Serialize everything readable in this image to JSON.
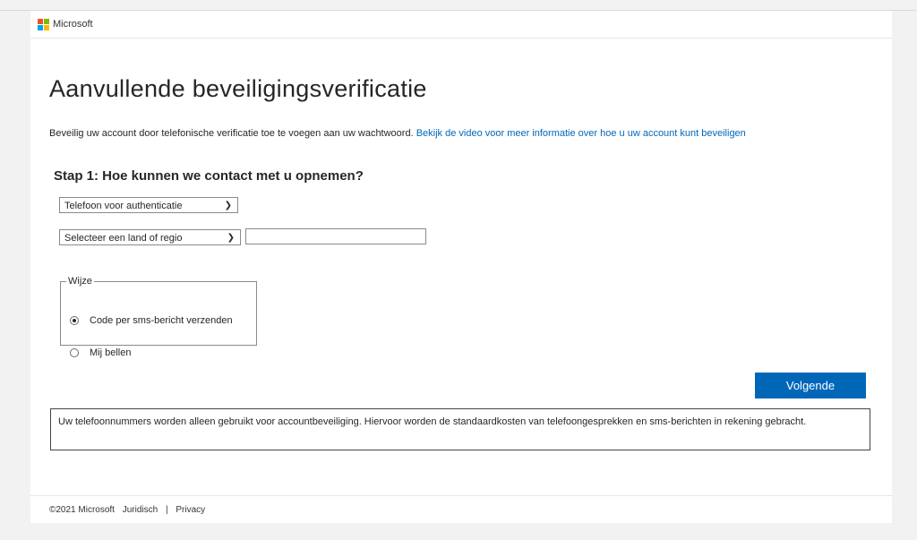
{
  "header": {
    "brand": "Microsoft"
  },
  "page": {
    "title": "Aanvullende beveiligingsverificatie",
    "intro_text": "Beveilig uw account door telefonische verificatie toe te voegen aan uw wachtwoord.",
    "intro_link": "Bekijk de video voor meer informatie over hoe u uw account kunt beveiligen"
  },
  "step1": {
    "heading": "Stap 1: Hoe kunnen we contact met u opnemen?",
    "method_select": "Telefoon voor authenticatie",
    "country_select": "Selecteer een land of regio",
    "phone_value": "",
    "method_group": {
      "legend": "Wijze",
      "options": [
        {
          "label": "Code per sms-bericht verzenden",
          "checked": true
        },
        {
          "label": "Mij bellen",
          "checked": false
        }
      ]
    }
  },
  "actions": {
    "next_label": "Volgende"
  },
  "notice": "Uw telefoonnummers worden alleen gebruikt voor accountbeveiliging. Hiervoor worden de standaardkosten van telefoongesprekken en sms-berichten in rekening gebracht.",
  "footer": {
    "copyright": "©2021 Microsoft",
    "legal": "Juridisch",
    "separator": "|",
    "privacy": "Privacy"
  },
  "colors": {
    "accent": "#0067b8",
    "logo_red": "#f25022",
    "logo_green": "#7fba00",
    "logo_blue": "#00a4ef",
    "logo_yellow": "#ffb900"
  }
}
